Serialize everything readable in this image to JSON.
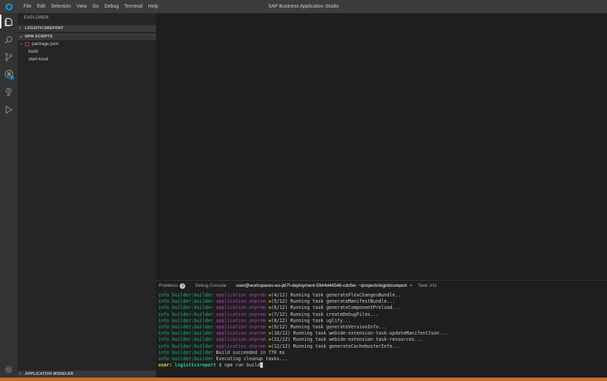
{
  "titlebar": {
    "menu": [
      "File",
      "Edit",
      "Selection",
      "View",
      "Go",
      "Debug",
      "Terminal",
      "Help"
    ],
    "title": "SAP Business Application Studio"
  },
  "activitybar": {
    "items": [
      {
        "name": "explorer-icon",
        "active": true
      },
      {
        "name": "search-icon",
        "active": false
      },
      {
        "name": "source-control-icon",
        "active": false
      },
      {
        "name": "extensions-icon",
        "active": false,
        "badge": "1"
      },
      {
        "name": "remote-explorer-icon",
        "active": false
      },
      {
        "name": "run-debug-icon",
        "active": false
      }
    ],
    "bottom": "settings-gear-icon"
  },
  "sidebar": {
    "title": "EXPLORER",
    "sections": {
      "project": "LOGISTICSREPORT",
      "npm": "NPM SCRIPTS",
      "modeler": "APPLICATION MODELER"
    },
    "package_file": "package.json",
    "scripts": [
      "build",
      "start-local"
    ]
  },
  "panel": {
    "tabs": {
      "problems": "Problems",
      "problems_count": "1",
      "debug": "Debug Console",
      "terminal": "user@workspaces-ws-jbl7f-deployment-5944d44546-cdv5w: ~/projects/logisticsreport",
      "task": "Task: #11"
    },
    "terminal_lines": [
      {
        "prefix": "info",
        "builder": "builder:builder",
        "app": "application onprem",
        "text": "(4/12) Running task generateFlexChangesBundle..."
      },
      {
        "prefix": "info",
        "builder": "builder:builder",
        "app": "application onprem",
        "text": "(5/12) Running task generateManifestBundle..."
      },
      {
        "prefix": "info",
        "builder": "builder:builder",
        "app": "application onprem",
        "text": "(6/12) Running task generateComponentPreload..."
      },
      {
        "prefix": "info",
        "builder": "builder:builder",
        "app": "application onprem",
        "text": "(7/12) Running task createDebugFiles..."
      },
      {
        "prefix": "info",
        "builder": "builder:builder",
        "app": "application onprem",
        "text": "(8/12) Running task uglify..."
      },
      {
        "prefix": "info",
        "builder": "builder:builder",
        "app": "application onprem",
        "text": "(9/12) Running task generateVersionInfo..."
      },
      {
        "prefix": "info",
        "builder": "builder:builder",
        "app": "application onprem",
        "text": "(10/12) Running task webide-extension-task-updateManifestJson..."
      },
      {
        "prefix": "info",
        "builder": "builder:builder",
        "app": "application onprem",
        "text": "(11/12) Running task webide-extension-task-resources..."
      },
      {
        "prefix": "info",
        "builder": "builder:builder",
        "app": "application onprem",
        "text": "(12/12) Running task generateCachebusterInfo..."
      },
      {
        "prefix": "info",
        "builder": "builder:builder",
        "app": "",
        "text": "Build succeeded in 770 ms"
      },
      {
        "prefix": "info",
        "builder": "builder:builder",
        "app": "",
        "text": "Executing cleanup tasks..."
      }
    ],
    "prompt": {
      "user": "user:",
      "dir": "logisticsreport",
      "symbol": "$",
      "command": "npm run build"
    }
  },
  "colors": {
    "accent": "#0e639c",
    "statusbar": "#d16c1a",
    "terminal_green": "#0dbc79",
    "terminal_magenta": "#bc3fbc",
    "terminal_yellow": "#e5e510"
  }
}
